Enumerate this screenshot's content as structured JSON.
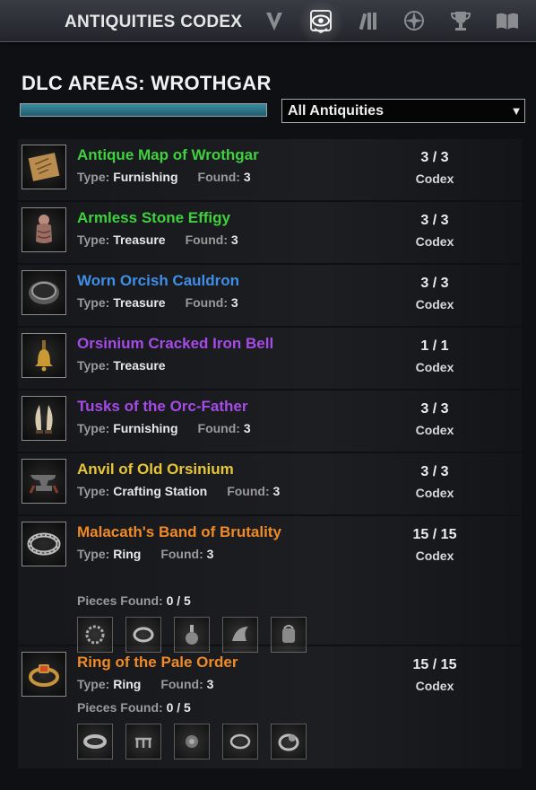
{
  "header": {
    "title": "ANTIQUITIES CODEX",
    "tabs": [
      {
        "icon": "checkmark-v-icon",
        "active": false
      },
      {
        "icon": "codex-eye-icon",
        "active": true
      },
      {
        "icon": "shovel-bars-icon",
        "active": false
      },
      {
        "icon": "compass-star-icon",
        "active": false
      },
      {
        "icon": "trophy-icon",
        "active": false
      },
      {
        "icon": "open-book-icon",
        "active": false
      }
    ]
  },
  "section": {
    "heading": "DLC AREAS: WROTHGAR",
    "progress": 1.0,
    "filter_value": "All Antiquities"
  },
  "labels": {
    "type": "Type:",
    "found": "Found:",
    "codex": "Codex",
    "pieces_found": "Pieces Found:"
  },
  "colors": {
    "green": "#3fd13d",
    "blue": "#3f8ee8",
    "purple": "#a64ae8",
    "gold": "#e8c63a",
    "orange": "#f08a26"
  },
  "entries": [
    {
      "name": "Antique Map of Wrothgar",
      "quality": "green",
      "icon": "map-scroll-icon",
      "type": "Furnishing",
      "found": "3",
      "count": "3 / 3"
    },
    {
      "name": "Armless Stone Effigy",
      "quality": "green",
      "icon": "stone-effigy-icon",
      "type": "Treasure",
      "found": "3",
      "count": "3 / 3"
    },
    {
      "name": "Worn Orcish Cauldron",
      "quality": "blue",
      "icon": "cauldron-icon",
      "type": "Treasure",
      "found": "3",
      "count": "3 / 3"
    },
    {
      "name": "Orsinium Cracked Iron Bell",
      "quality": "purple",
      "icon": "bell-icon",
      "type": "Treasure",
      "found": "",
      "count": "1 / 1"
    },
    {
      "name": "Tusks of the Orc-Father",
      "quality": "purple",
      "icon": "tusks-icon",
      "type": "Furnishing",
      "found": "3",
      "count": "3 / 3"
    },
    {
      "name": "Anvil of Old Orsinium",
      "quality": "gold",
      "icon": "anvil-icon",
      "type": "Crafting Station",
      "found": "3",
      "count": "3 / 3"
    },
    {
      "name": "Malacath's Band of Brutality",
      "quality": "orange",
      "icon": "ring-band-icon",
      "type": "Ring",
      "found": "3",
      "count": "15 / 15",
      "pieces_found": "0 / 5",
      "pieces": [
        "chain-ring-piece-icon",
        "plain-ring-piece-icon",
        "vial-piece-icon",
        "claw-piece-icon",
        "pouch-piece-icon"
      ]
    },
    {
      "name": "Ring of the Pale Order",
      "quality": "orange",
      "icon": "gem-ring-icon",
      "type": "Ring",
      "found": "3",
      "count": "15 / 15",
      "pieces_found": "0 / 5",
      "pieces": [
        "band-piece-icon",
        "setting-piece-icon",
        "gem-piece-icon",
        "thin-ring-piece-icon",
        "signet-piece-icon"
      ]
    }
  ]
}
